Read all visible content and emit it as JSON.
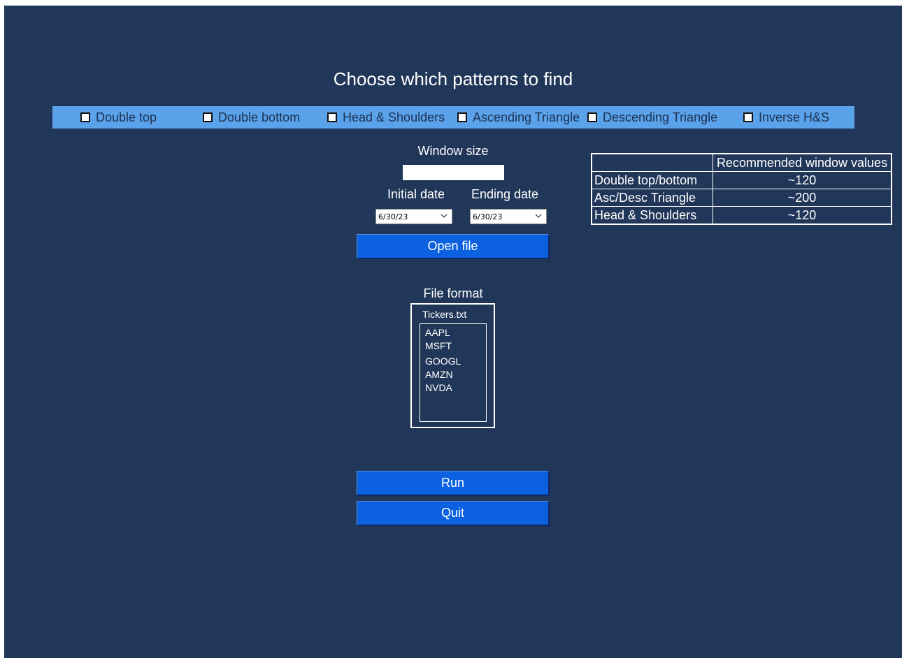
{
  "title": "Choose which patterns to find",
  "patterns": [
    {
      "label": "Double top",
      "checked": false
    },
    {
      "label": "Double bottom",
      "checked": false
    },
    {
      "label": "Head & Shoulders",
      "checked": false
    },
    {
      "label": "Ascending Triangle",
      "checked": false
    },
    {
      "label": "Descending Triangle",
      "checked": false
    },
    {
      "label": "Inverse H&S",
      "checked": false
    }
  ],
  "window_size": {
    "label": "Window size",
    "value": ""
  },
  "initial_date": {
    "label": "Initial date",
    "value": "6/30/23"
  },
  "ending_date": {
    "label": "Ending date",
    "value": "6/30/23"
  },
  "buttons": {
    "open_file": "Open file",
    "run": "Run",
    "quit": "Quit"
  },
  "file_format": {
    "label": "File format",
    "file_name": "Tickers.txt",
    "tickers": [
      "AAPL",
      "MSFT",
      "GOOGL",
      "AMZN",
      "NVDA"
    ]
  },
  "recommendations": {
    "header": "Recommended window values",
    "rows": [
      {
        "pattern": "Double top/bottom",
        "value": "~120"
      },
      {
        "pattern": "Asc/Desc Triangle",
        "value": "~200"
      },
      {
        "pattern": "Head & Shoulders",
        "value": "~120"
      }
    ]
  },
  "colors": {
    "background": "#213759",
    "pattern_bar": "#5aa2ea",
    "button": "#0b61e0"
  }
}
